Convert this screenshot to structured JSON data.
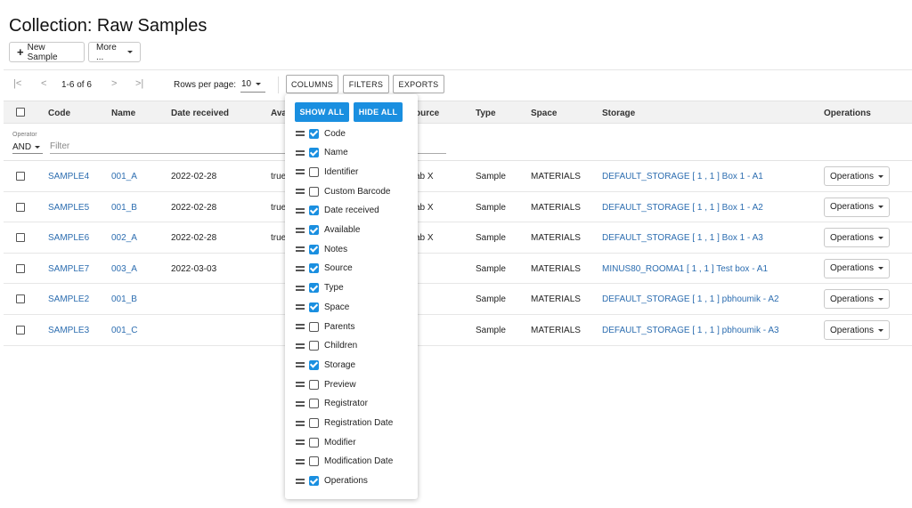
{
  "page": {
    "title": "Collection: Raw Samples"
  },
  "actions": {
    "new_sample": "New Sample",
    "more": "More ..."
  },
  "toolbar": {
    "range": "1-6 of 6",
    "rows_per_page_label": "Rows per page:",
    "rows_per_page_value": "10",
    "columns": "COLUMNS",
    "filters": "FILTERS",
    "exports": "EXPORTS"
  },
  "table": {
    "headers": {
      "code": "Code",
      "name": "Name",
      "date_received": "Date received",
      "available": "Ava",
      "source": "ource",
      "type": "Type",
      "space": "Space",
      "storage": "Storage",
      "operations": "Operations"
    },
    "filter": {
      "operator_label": "Operator",
      "operator_value": "AND",
      "placeholder": "Filter"
    },
    "rows": [
      {
        "code": "SAMPLE4",
        "name": "001_A",
        "date": "2022-02-28",
        "available": "true",
        "source": "ab X",
        "type": "Sample",
        "space": "MATERIALS",
        "storage": "DEFAULT_STORAGE [ 1 , 1 ] Box 1 - A1",
        "ops": "Operations"
      },
      {
        "code": "SAMPLE5",
        "name": "001_B",
        "date": "2022-02-28",
        "available": "true",
        "source": "ab X",
        "type": "Sample",
        "space": "MATERIALS",
        "storage": "DEFAULT_STORAGE [ 1 , 1 ] Box 1 - A2",
        "ops": "Operations"
      },
      {
        "code": "SAMPLE6",
        "name": "002_A",
        "date": "2022-02-28",
        "available": "true",
        "source": "ab X",
        "type": "Sample",
        "space": "MATERIALS",
        "storage": "DEFAULT_STORAGE [ 1 , 1 ] Box 1 - A3",
        "ops": "Operations"
      },
      {
        "code": "SAMPLE7",
        "name": "003_A",
        "date": "2022-03-03",
        "available": "",
        "source": "",
        "type": "Sample",
        "space": "MATERIALS",
        "storage": "MINUS80_ROOMA1 [ 1 , 1 ] Test box - A1",
        "ops": "Operations"
      },
      {
        "code": "SAMPLE2",
        "name": "001_B",
        "date": "",
        "available": "",
        "source": "",
        "type": "Sample",
        "space": "MATERIALS",
        "storage": "DEFAULT_STORAGE [ 1 , 1 ] pbhoumik - A2",
        "ops": "Operations"
      },
      {
        "code": "SAMPLE3",
        "name": "001_C",
        "date": "",
        "available": "",
        "source": "",
        "type": "Sample",
        "space": "MATERIALS",
        "storage": "DEFAULT_STORAGE [ 1 , 1 ] pbhoumik - A3",
        "ops": "Operations"
      }
    ]
  },
  "columns_popup": {
    "show_all": "SHOW ALL",
    "hide_all": "HIDE ALL",
    "items": [
      {
        "label": "Code",
        "checked": true
      },
      {
        "label": "Name",
        "checked": true
      },
      {
        "label": "Identifier",
        "checked": false
      },
      {
        "label": "Custom Barcode",
        "checked": false
      },
      {
        "label": "Date received",
        "checked": true
      },
      {
        "label": "Available",
        "checked": true
      },
      {
        "label": "Notes",
        "checked": true
      },
      {
        "label": "Source",
        "checked": true
      },
      {
        "label": "Type",
        "checked": true
      },
      {
        "label": "Space",
        "checked": true
      },
      {
        "label": "Parents",
        "checked": false
      },
      {
        "label": "Children",
        "checked": false
      },
      {
        "label": "Storage",
        "checked": true
      },
      {
        "label": "Preview",
        "checked": false
      },
      {
        "label": "Registrator",
        "checked": false
      },
      {
        "label": "Registration Date",
        "checked": false
      },
      {
        "label": "Modifier",
        "checked": false
      },
      {
        "label": "Modification Date",
        "checked": false
      },
      {
        "label": "Operations",
        "checked": true
      }
    ]
  },
  "colors": {
    "accent": "#1a8fe0",
    "link": "#2c6db0"
  },
  "icons": {
    "first_page": "first-page-icon",
    "prev_page": "prev-page-icon",
    "next_page": "next-page-icon",
    "last_page": "last-page-icon"
  }
}
